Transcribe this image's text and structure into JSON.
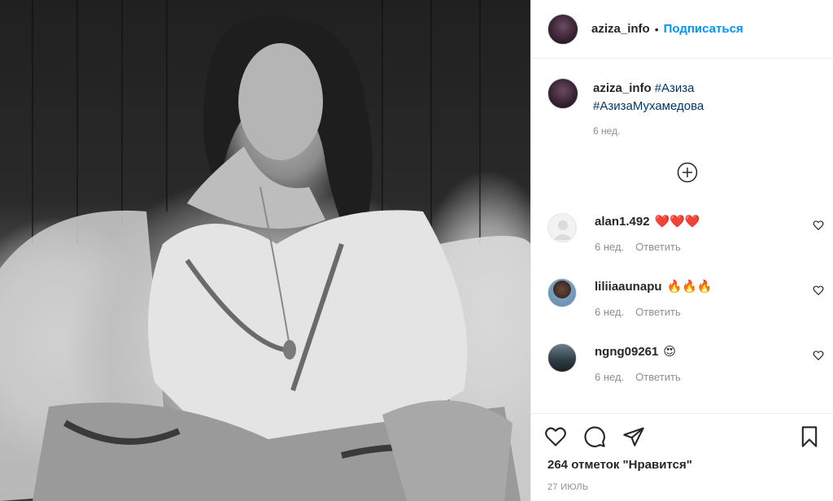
{
  "post": {
    "image_alt": "",
    "author": "aziza_info",
    "follow_label": "Подписаться",
    "caption": {
      "username": "aziza_info",
      "hashtags": [
        "#Азиза",
        "#АзизаМухамедова"
      ],
      "time": "6 нед."
    },
    "comments": [
      {
        "username": "alan1.492",
        "text": "❤️❤️❤️",
        "time": "6 нед.",
        "reply_label": "Ответить"
      },
      {
        "username": "liliiaaunapu",
        "text": "🔥🔥🔥",
        "time": "6 нед.",
        "reply_label": "Ответить"
      },
      {
        "username": "ngng09261",
        "text": "😍",
        "time": "6 нед.",
        "reply_label": "Ответить"
      }
    ],
    "likes": "264 отметок \"Нравится\"",
    "date": "27 ИЮЛЬ"
  },
  "icons": {
    "load_more": "plus-circle-icon",
    "like": "heart-icon",
    "comment": "comment-icon",
    "share": "paper-plane-icon",
    "save": "bookmark-icon"
  },
  "colors": {
    "accent": "#0095f6",
    "hashtag": "#00376b",
    "muted": "#8e8e8e"
  }
}
